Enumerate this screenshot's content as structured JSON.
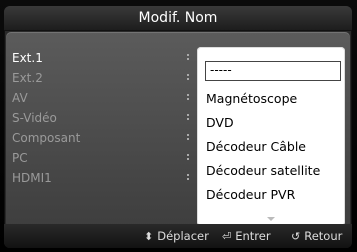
{
  "window": {
    "title": "Modif. Nom"
  },
  "left_menu": {
    "items": [
      {
        "label": "Ext.1",
        "active": true
      },
      {
        "label": "Ext.2",
        "active": false
      },
      {
        "label": "AV",
        "active": false
      },
      {
        "label": "S-Vidéo",
        "active": false
      },
      {
        "label": "Composant",
        "active": false
      },
      {
        "label": "PC",
        "active": false
      },
      {
        "label": "HDMI1",
        "active": false
      }
    ]
  },
  "dropdown": {
    "selected": "-----",
    "options": [
      "Magnétoscope",
      "DVD",
      "Décodeur Câble",
      "Décodeur satellite",
      "Décodeur PVR"
    ],
    "more_indicator_icon": "chevron-down-icon"
  },
  "footer": {
    "move": {
      "icon": "updown-arrow-icon",
      "label": "Déplacer"
    },
    "enter": {
      "icon": "enter-icon",
      "label": "Entrer"
    },
    "return": {
      "icon": "return-icon",
      "label": "Retour"
    }
  }
}
